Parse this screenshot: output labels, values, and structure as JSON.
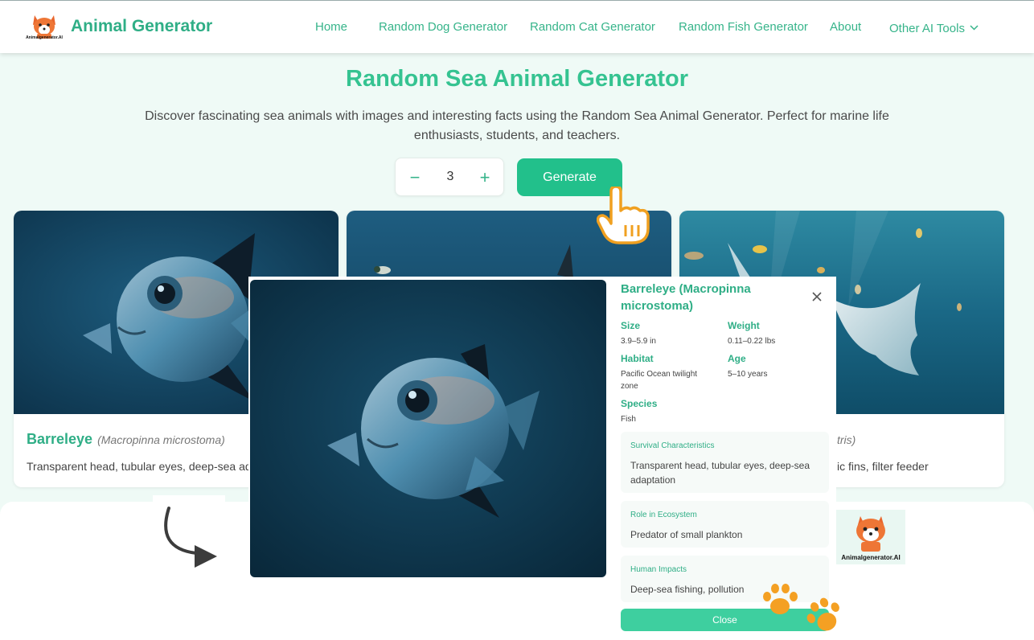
{
  "header": {
    "brand": "Animal Generator",
    "logo_caption": "Animalgenerator.AI",
    "nav": [
      "Home",
      "Random Dog Generator",
      "Random Cat Generator",
      "Random Fish Generator",
      "About",
      "Other AI Tools"
    ]
  },
  "hero": {
    "title": "Random Sea Animal Generator",
    "description": "Discover fascinating sea animals with images and interesting facts using the Random Sea Animal Generator. Perfect for marine life enthusiasts, students, and teachers.",
    "quantity": "3",
    "minus": "−",
    "plus": "+",
    "generate_label": "Generate"
  },
  "cards": [
    {
      "name": "Barreleye",
      "scientific": "(Macropinna microstoma)",
      "text": "Transparent head, tubular eyes, deep-sea adaptation"
    },
    {
      "name": "",
      "scientific": "",
      "text": ""
    },
    {
      "name": "",
      "scientific": "tris)",
      "text": "ic fins, filter feeder"
    }
  ],
  "modal": {
    "title": "Barreleye (Macropinna microstoma)",
    "fields": {
      "size_label": "Size",
      "size": "3.9–5.9 in",
      "weight_label": "Weight",
      "weight": "0.11–0.22 lbs",
      "habitat_label": "Habitat",
      "habitat": "Pacific Ocean twilight zone",
      "age_label": "Age",
      "age": "5–10 years",
      "species_label": "Species",
      "species": "Fish"
    },
    "sections": [
      {
        "heading": "Survival Characteristics",
        "text": "Transparent head, tubular eyes, deep-sea adaptation"
      },
      {
        "heading": "Role in Ecosystem",
        "text": "Predator of small plankton"
      },
      {
        "heading": "Human Impacts",
        "text": "Deep-sea fishing, pollution"
      }
    ],
    "close_label": "Close"
  },
  "footer_logo_caption": "Animalgenerator.AI",
  "colors": {
    "accent": "#2fae86",
    "button": "#22c08b",
    "hero_bg": "#effaf6",
    "paw": "#f4a023"
  },
  "icons": [
    "fox-logo-icon",
    "chevron-down-icon",
    "pointing-hand-icon",
    "curved-arrow-icon",
    "close-icon",
    "paw-icon"
  ]
}
